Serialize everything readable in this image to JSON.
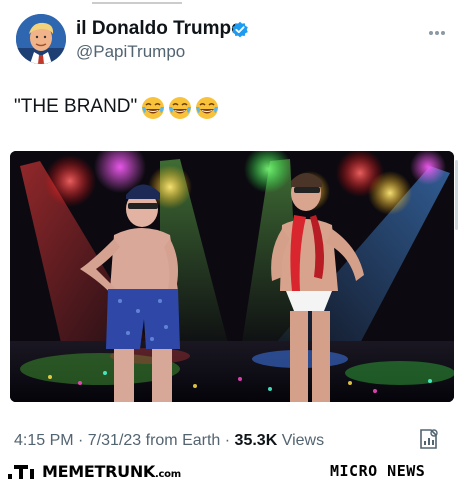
{
  "post": {
    "display_name": "il Donaldo Trumpo",
    "handle": "@PapiTrumpo",
    "text": "\"THE BRAND\"",
    "emoji": [
      "laughing-tears",
      "laughing-tears",
      "laughing-tears"
    ],
    "timestamp": "4:15 PM · 7/31/23 from Earth · ",
    "views_count": "35.3K",
    "views_label": " Views"
  },
  "footer": {
    "brand_name": "MEMETRUNK",
    "brand_suffix": ".com",
    "micro_news": "MICRO NEWS"
  },
  "colors": {
    "verified": "#1d9bf0",
    "text": "#0f1419",
    "secondary": "#536471"
  },
  "icons": [
    "verified-badge-icon",
    "more-icon",
    "analytics-icon",
    "laughing-emoji-icon",
    "memetrunk-logo-icon"
  ]
}
